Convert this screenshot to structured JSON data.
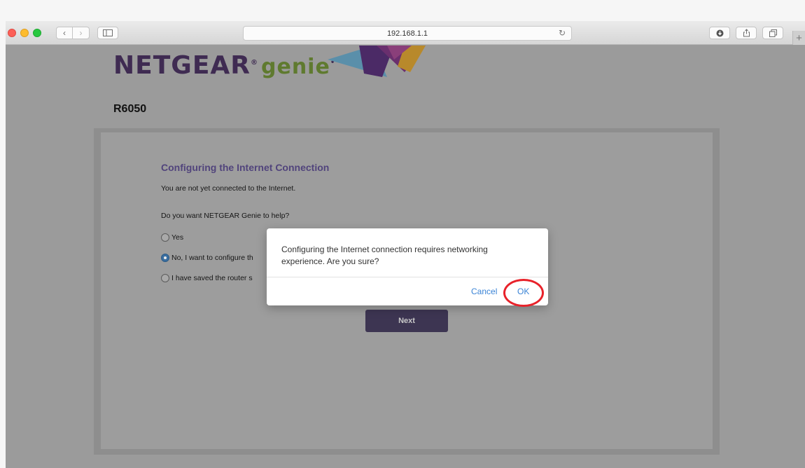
{
  "browser": {
    "address": "192.168.1.1",
    "icons": {
      "back": "chevron-left-icon",
      "forward": "chevron-right-icon",
      "sidebar": "sidebar-icon",
      "reload": "reload-icon",
      "download": "download-icon",
      "share": "share-icon",
      "tabs": "tabs-icon",
      "new_tab": "plus-icon"
    }
  },
  "page": {
    "logo_netgear": "NETGEAR",
    "logo_genie": "genie",
    "model": "R6050",
    "section_title": "Configuring the Internet Connection",
    "status_text": "You are not yet connected to the Internet.",
    "question": "Do you want NETGEAR Genie to help?",
    "options": [
      {
        "label": "Yes",
        "checked": false
      },
      {
        "label": "No, I want to configure th",
        "checked": true
      },
      {
        "label": "I have saved the router s",
        "checked": false
      }
    ],
    "next_label": "Next"
  },
  "dialog": {
    "message": "Configuring the Internet connection requires networking experience. Are you sure?",
    "cancel_label": "Cancel",
    "ok_label": "OK"
  },
  "colors": {
    "accent_link": "#3b84d6",
    "title_purple": "#51447c",
    "highlight_red": "#e8222a"
  }
}
